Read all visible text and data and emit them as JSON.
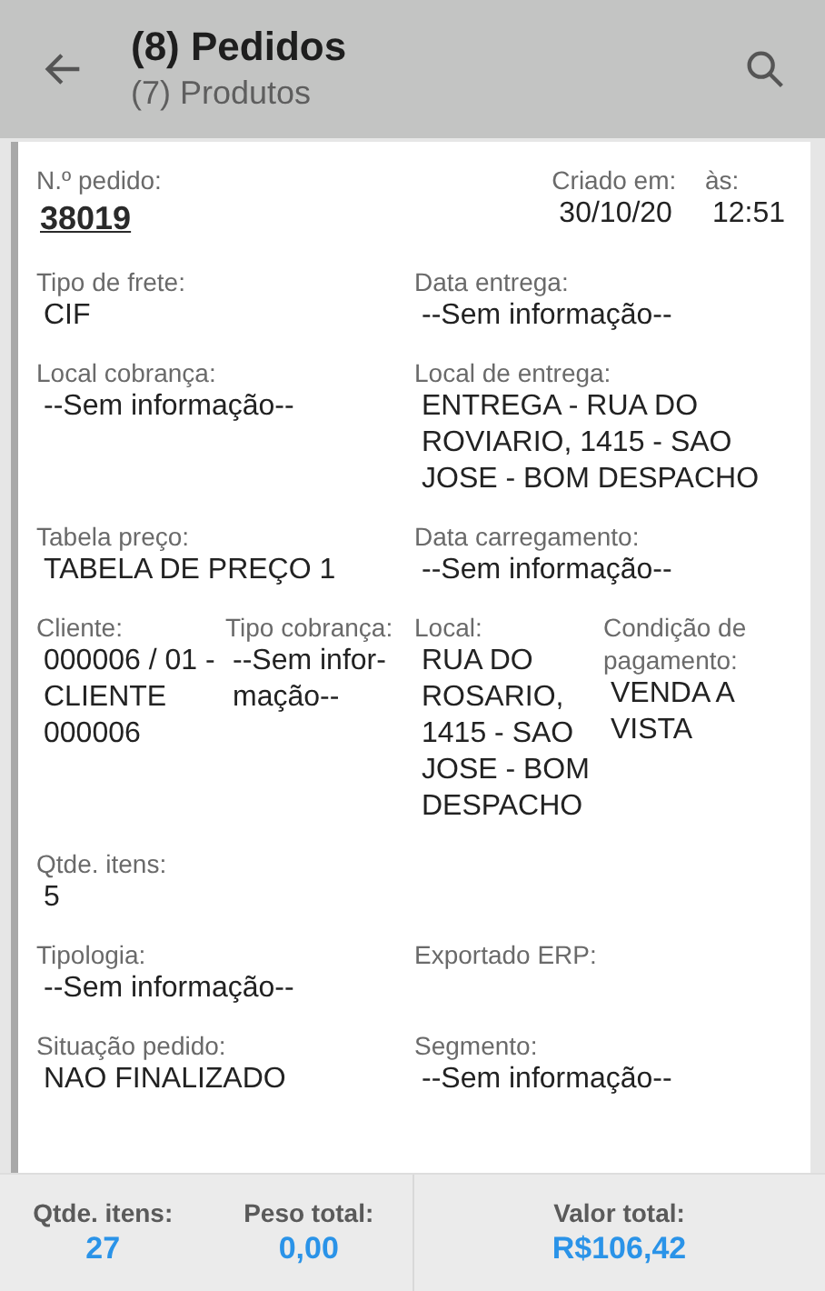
{
  "app_bar": {
    "title": "(8) Pedidos",
    "subtitle": "(7) Produtos"
  },
  "order": {
    "number_label": "N.º pedido:",
    "number": "38019",
    "created_label": "Criado em:",
    "created_date": "30/10/20",
    "time_label": "às:",
    "time": "12:51"
  },
  "rows": [
    [
      {
        "label": "Tipo de frete:",
        "value": "CIF"
      },
      {
        "label": "Data entrega:",
        "value": "--Sem informação--"
      }
    ],
    [
      {
        "label": "Local cobrança:",
        "value": "--Sem informação--"
      },
      {
        "label": "Local de entrega:",
        "value": "ENTREGA - RUA DO ROVIARIO, 1415 - SAO JOSE - BOM DESPACHO"
      }
    ],
    [
      {
        "label": "Tabela preço:",
        "value": "TABELA DE PREÇO 1"
      },
      {
        "label": "Data carregamento:",
        "value": "--Sem informação--"
      }
    ],
    [
      {
        "label": "Cliente:",
        "value": "000006 / 01 - CLIENTE 000006"
      },
      {
        "label": "Tipo cobrança:",
        "value": "--Sem infor-mação--"
      },
      {
        "label": "Local:",
        "value": "RUA DO ROSARIO, 1415 - SAO JOSE - BOM DESPACHO"
      },
      {
        "label": "Condição de pagamento:",
        "value": "VENDA A VISTA"
      }
    ],
    [
      {
        "label": "Qtde. itens:",
        "value": "5"
      }
    ],
    [
      {
        "label": "Tipologia:",
        "value": "--Sem informação--"
      },
      {
        "label": "Exportado ERP:"
      }
    ],
    [
      {
        "label": "Situação pedido:",
        "value": "NAO FINALIZADO"
      },
      {
        "label": "Segmento:",
        "value": "--Sem informação--"
      }
    ]
  ],
  "totals": [
    {
      "label": "Qtde. itens:",
      "value": "27"
    },
    {
      "label": "Peso total:",
      "value": "0,00"
    },
    {
      "label": "Valor total:",
      "value": "R$106,42"
    }
  ]
}
